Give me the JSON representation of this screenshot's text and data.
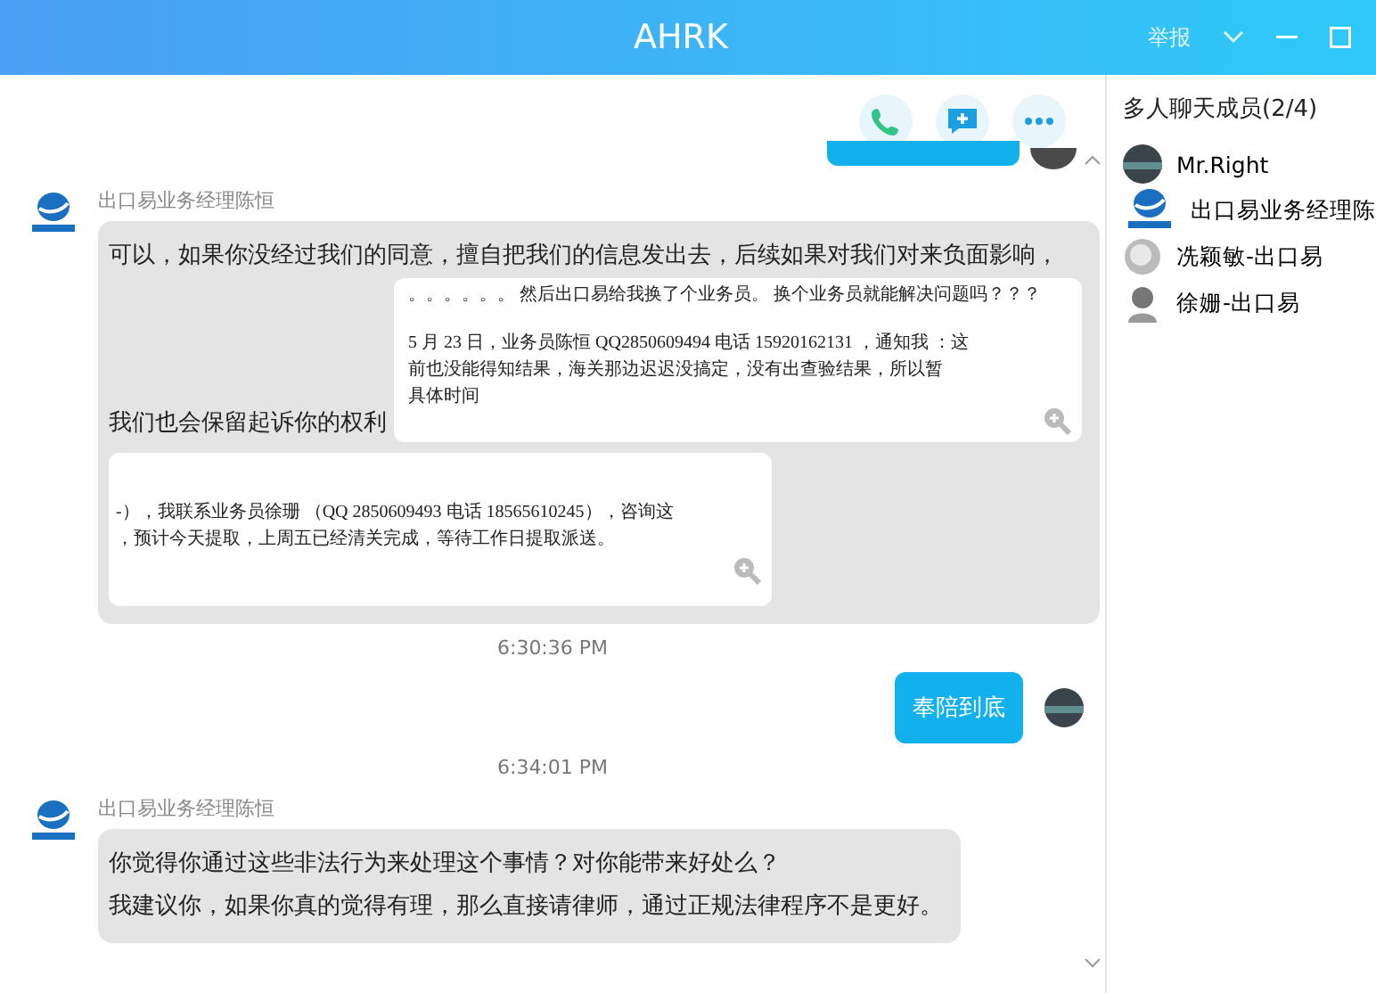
{
  "window": {
    "title": "AHRK",
    "actions": [
      {
        "kind": "text",
        "label": "举报"
      },
      {
        "kind": "chevron"
      },
      {
        "kind": "minimize"
      },
      {
        "kind": "maximize"
      }
    ]
  },
  "toolbar": [
    {
      "kind": "phone"
    },
    {
      "kind": "add-message"
    },
    {
      "kind": "more"
    }
  ],
  "messages": [
    {
      "kind": "outgoing_cut"
    },
    {
      "kind": "incoming",
      "sender": "出口易业务经理陈恒",
      "blocks": [
        {
          "kind": "text",
          "text": "可以，如果你没经过我们的同意，擅自把我们的信息发出去，后续如果对我们对来负面影响，"
        },
        {
          "kind": "image_text_row",
          "text": "我们也会保留起诉你的权利",
          "paragraphs": [
            [
              "。。。。。。 然后出口易给我换了个业务员。 换个业务员就能解决问题吗？？？"
            ],
            [
              "5 月 23 日，业务员陈恒 QQ2850609494 电话 15920162131 ，通知我 ：这",
              "前也没能得知结果，海关那边迟迟没搞定，没有出查验结果，所以暂",
              "具体时间"
            ]
          ]
        },
        {
          "kind": "image",
          "paragraphs": [
            [
              "-），我联系业务员徐珊 （QQ 2850609493 电话 18565610245），咨询这",
              "，预计今天提取，上周五已经清关完成，等待工作日提取派送。"
            ]
          ]
        }
      ]
    },
    {
      "kind": "time",
      "text": "6:30:36 PM"
    },
    {
      "kind": "outgoing",
      "text": "奉陪到底"
    },
    {
      "kind": "time",
      "text": "6:34:01 PM"
    },
    {
      "kind": "incoming",
      "sender": "出口易业务经理陈恒",
      "blocks": [
        {
          "kind": "text",
          "text": "你觉得你通过这些非法行为来处理这个事情？对你能带来好处么？"
        },
        {
          "kind": "text",
          "text": "我建议你，如果你真的觉得有理，那么直接请律师，通过正规法律程序不是更好。"
        }
      ]
    }
  ],
  "members": {
    "title": "多人聊天成员(2/4)",
    "items": [
      {
        "name": "Mr.Right",
        "kind": "photo"
      },
      {
        "name": "出口易业务经理陈",
        "kind": "logo"
      },
      {
        "name": "冼颖敏-出口易",
        "kind": "gray"
      },
      {
        "name": "徐姗-出口易",
        "kind": "figure"
      }
    ]
  }
}
